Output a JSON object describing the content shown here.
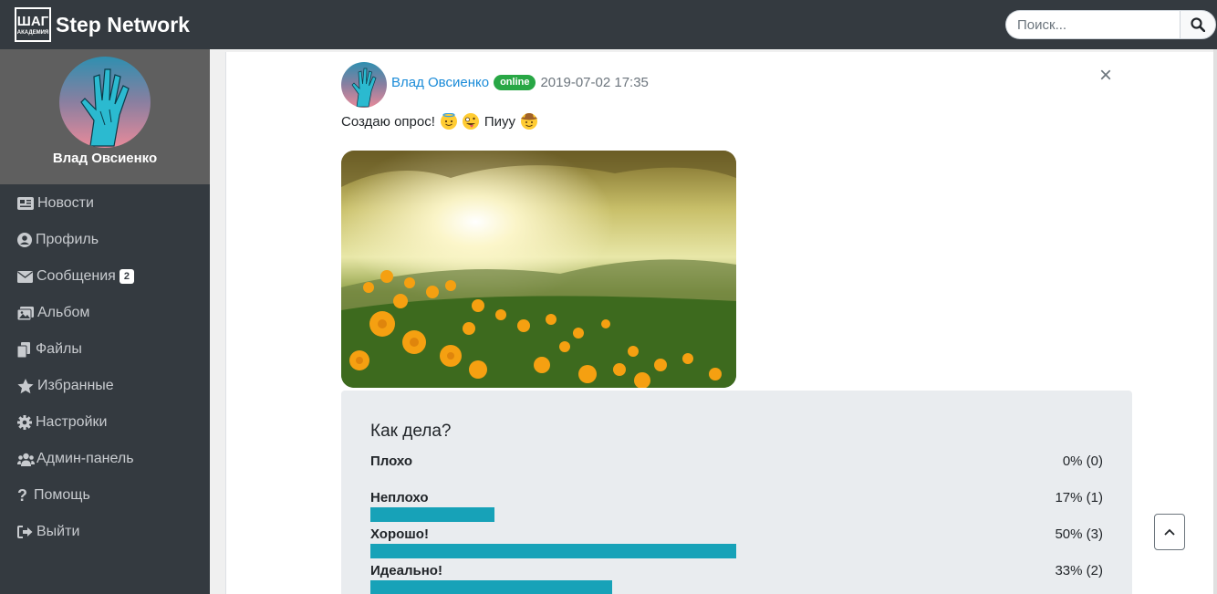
{
  "brand": {
    "logo_text": "ШАГ",
    "logo_sub": "АКАДЕМИЯ",
    "name": "Step Network"
  },
  "search": {
    "placeholder": "Поиск...",
    "value": ""
  },
  "user": {
    "name": "Влад Овсиенко"
  },
  "sidebar": {
    "items": [
      {
        "label": "Новости",
        "icon": "newspaper-icon"
      },
      {
        "label": "Профиль",
        "icon": "user-circle-icon"
      },
      {
        "label": "Сообщения",
        "icon": "envelope-icon",
        "badge": "2"
      },
      {
        "label": "Альбом",
        "icon": "images-icon"
      },
      {
        "label": "Файлы",
        "icon": "files-icon"
      },
      {
        "label": "Избранные",
        "icon": "star-icon"
      },
      {
        "label": "Настройки",
        "icon": "gear-icon"
      },
      {
        "label": "Админ-панель",
        "icon": "users-cog-icon"
      },
      {
        "label": "Помощь",
        "icon": "question-icon"
      },
      {
        "label": "Выйти",
        "icon": "sign-out-icon"
      }
    ]
  },
  "post": {
    "author": "Влад Овсиенко",
    "status": "online",
    "date": "2019-07-02 17:35",
    "text": "Создаю опрос!",
    "text_tail": "Пиуу",
    "emojis": [
      "smiling-face-with-halo",
      "zany-face",
      "cowboy-hat-face"
    ],
    "image_alt": "sunset meadow with orange flowers"
  },
  "poll": {
    "question": "Как дела?",
    "options": [
      {
        "label": "Плохо",
        "result": "0% (0)",
        "percent": 0
      },
      {
        "label": "Неплохо",
        "result": "17% (1)",
        "percent": 17
      },
      {
        "label": "Хорошо!",
        "result": "50% (3)",
        "percent": 50
      },
      {
        "label": "Идеально!",
        "result": "33% (2)",
        "percent": 33
      }
    ]
  },
  "colors": {
    "navbar": "#343a40",
    "accent": "#17a2b8",
    "online": "#28a745",
    "link": "#1a8bd8"
  }
}
